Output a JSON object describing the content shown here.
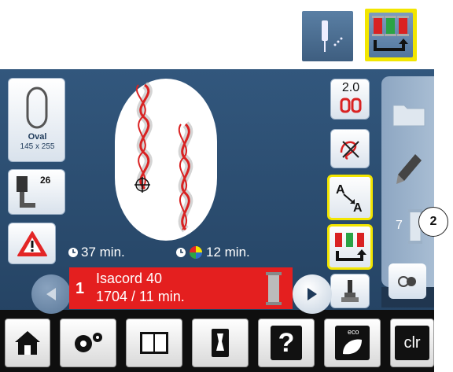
{
  "top_buttons": {
    "needle_icon": "needle-position-icon",
    "multicolor_icon": "color-change-icon"
  },
  "hoop": {
    "name": "Oval",
    "size": "145 x 255"
  },
  "presser_foot": {
    "number": "26"
  },
  "stitch_info": {
    "time_total": "37 min.",
    "time_color": "12 min."
  },
  "zoom": {
    "value": "2.0"
  },
  "thread": {
    "index": "1",
    "brand": "Isacord 40",
    "detail": "1704 / 11 min."
  },
  "side_panel": {
    "stopper_number": "7"
  },
  "callout": {
    "number": "2"
  },
  "bottom_bar": {
    "help_label": "?",
    "eco_label": "eco",
    "clr_label": "clr"
  },
  "colors": {
    "background": "#223f5e",
    "thread_red": "#e41f1f",
    "highlight_yellow": "#f3e600"
  }
}
